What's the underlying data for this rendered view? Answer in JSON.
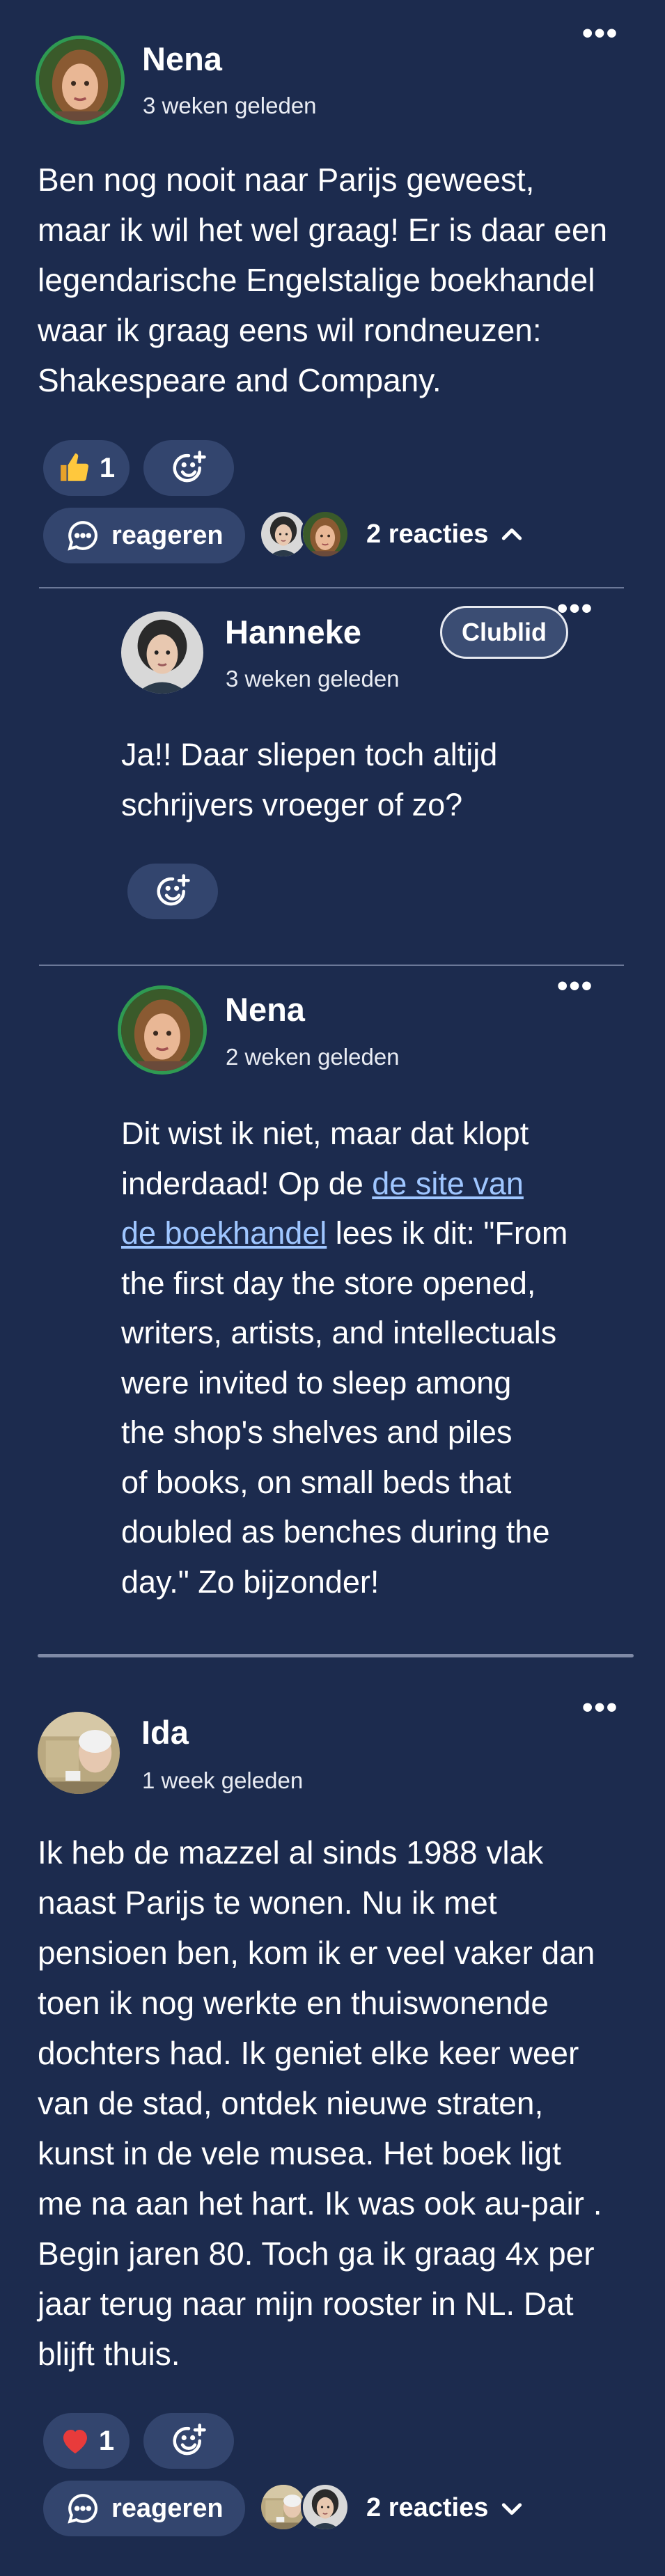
{
  "post1": {
    "author": "Nena",
    "time": "3 weken geleden",
    "text": "Ben nog nooit naar Parijs geweest,\nmaar ik wil het wel graag! Er is daar een\nlegendarische Engelstalige boekhandel\nwaar ik graag eens wil rondneuzen:\nShakespeare and Company.",
    "like_count": "1",
    "reply_label": "reageren",
    "reactions_label": "2 reacties",
    "more": "•••"
  },
  "reply1": {
    "author": "Hanneke",
    "badge": "Clublid",
    "time": "3 weken geleden",
    "text": "Ja!! Daar sliepen toch altijd\nschrijvers vroeger of zo?",
    "more": "•••"
  },
  "reply2": {
    "author": "Nena",
    "time": "2 weken geleden",
    "text_before": "Dit wist ik niet, maar dat klopt\ninderdaad! Op de ",
    "link": " de site van\nde boekhandel",
    "text_after": " lees ik dit: \"From\nthe first day the store opened,\nwriters, artists, and intellectuals\nwere invited to sleep among\nthe shop's shelves and piles\nof books, on small beds that\ndoubled as benches during the\nday.\" Zo bijzonder!",
    "more": "•••"
  },
  "post2": {
    "author": "Ida",
    "time": "1 week geleden",
    "text": "Ik heb de mazzel al sinds 1988 vlak\nnaast Parijs te wonen. Nu ik met\npensioen ben, kom ik er veel vaker dan\ntoen ik nog werkte en thuiswonende\ndochters had. Ik geniet elke keer weer\nvan de stad, ontdek nieuwe straten,\nkunst in de vele musea. Het boek ligt\nme na aan het hart. Ik was ook au-pair .\nBegin jaren 80.  Toch ga ik graag 4x per\njaar terug naar mijn rooster in NL. Dat\nblijft thuis.",
    "like_count": "1",
    "reply_label": "reageren",
    "reactions_label": "2 reacties",
    "more": "•••"
  },
  "icons": {
    "like": "thumbs-up-icon",
    "heart": "heart-icon",
    "add_reaction": "add-emoji-icon",
    "comment": "comment-bubble-icon",
    "chevron_up": "chevron-up-icon",
    "chevron_down": "chevron-down-icon"
  },
  "colors": {
    "background": "#1c2b4e",
    "pill": "#33456e",
    "link": "#9fc6ff",
    "avatar_ring": "#2f9a52"
  }
}
